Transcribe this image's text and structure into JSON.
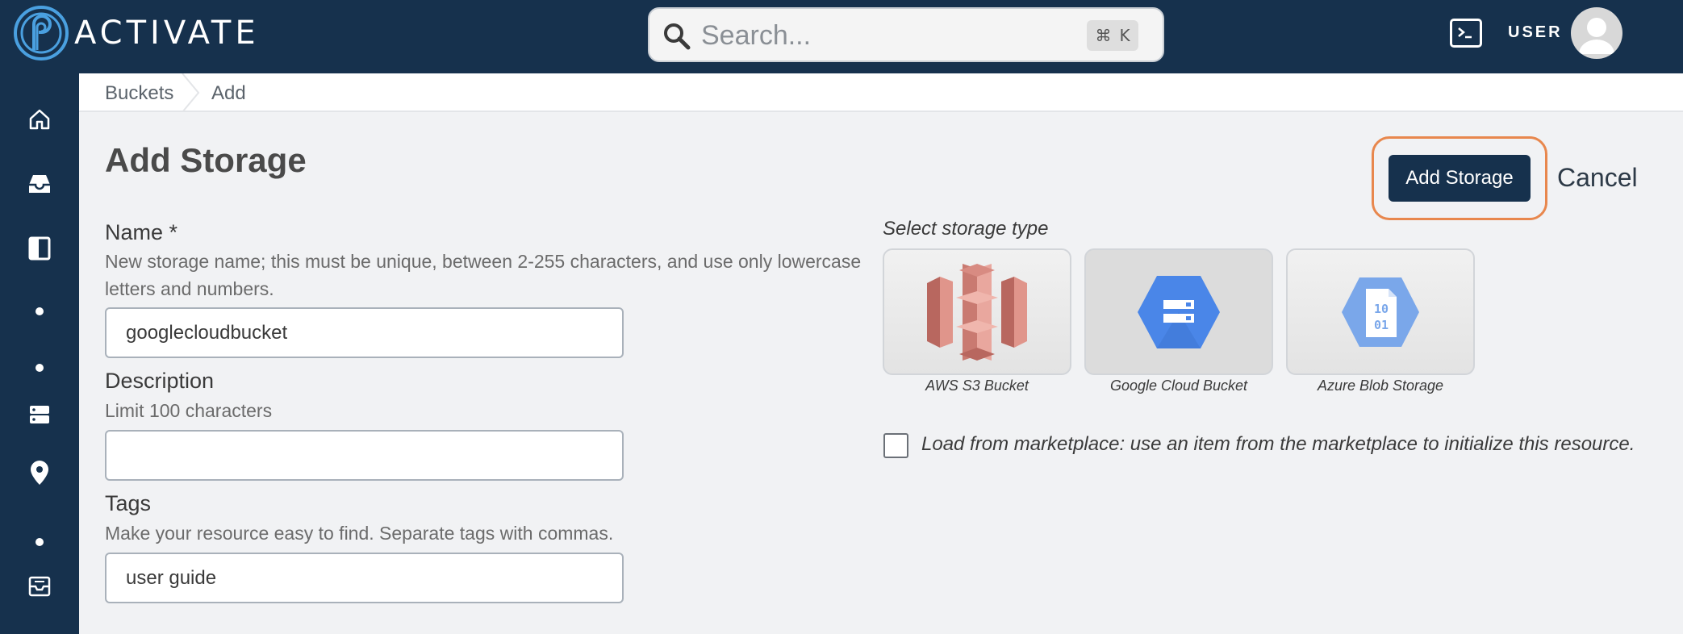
{
  "app": {
    "name": "ACTIVATE"
  },
  "search": {
    "placeholder": "Search...",
    "shortcut_symbol": "⌘",
    "shortcut_key": "K"
  },
  "header": {
    "user_label": "USER"
  },
  "breadcrumb": [
    "Buckets",
    "Add"
  ],
  "page": {
    "title": "Add Storage"
  },
  "actions": {
    "add_label": "Add Storage",
    "cancel_label": "Cancel"
  },
  "form": {
    "name": {
      "label": "Name *",
      "help_line1": "New storage name; this must be unique, between 2-255 characters, and use only lowercase",
      "help_line2": "letters and numbers.",
      "value": "googlecloudbucket"
    },
    "description": {
      "label": "Description",
      "help": "Limit 100 characters",
      "value": ""
    },
    "tags": {
      "label": "Tags",
      "help": "Make your resource easy to find. Separate tags with commas.",
      "value": "user guide"
    }
  },
  "storage_type": {
    "label": "Select storage type",
    "options": [
      {
        "caption": "AWS S3 Bucket",
        "icon": "aws-s3-icon",
        "selected": false
      },
      {
        "caption": "Google Cloud Bucket",
        "icon": "google-cloud-storage-icon",
        "selected": true
      },
      {
        "caption": "Azure Blob Storage",
        "icon": "azure-blob-icon",
        "selected": false
      }
    ]
  },
  "marketplace": {
    "label": "Load from marketplace: use an item from the marketplace to initialize this resource.",
    "checked": false
  },
  "sidebar": {
    "icons": [
      "home-icon",
      "inbox-icon",
      "panel-icon",
      "dot-icon",
      "dot-icon",
      "storage-icon",
      "location-pin-icon",
      "dot-icon",
      "archive-icon"
    ]
  },
  "colors": {
    "navy": "#16314d",
    "accent_orange": "#e8874d",
    "google_blue": "#4a86e8",
    "aws_salmon": "#e0958b",
    "azure_blue": "#7aa7ea"
  }
}
